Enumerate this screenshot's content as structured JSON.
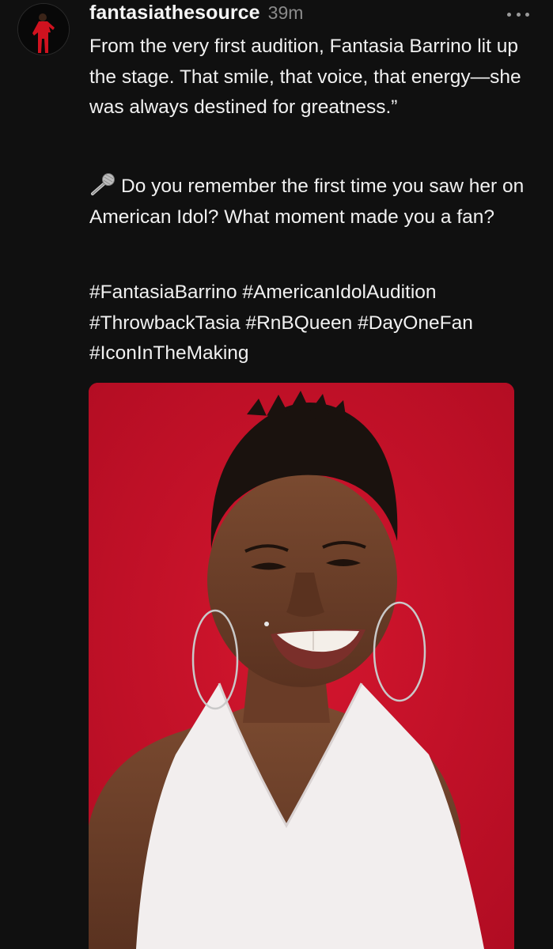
{
  "post": {
    "username": "fantasiathesource",
    "timestamp": "39m",
    "paragraph1": "From the very first audition, Fantasia Barrino lit up the stage. That smile, that voice, that energy—she was always destined for greatness.”",
    "paragraph2": "Do you remember the first time you saw her on American Idol? What moment made you a fan?",
    "paragraph2_icon": "microphone-icon",
    "hashtags": "#FantasiaBarrino #AmericanIdolAudition #ThrowbackTasia #RnBQueen #DayOneFan #IconInTheMaking"
  },
  "colors": {
    "background": "#101010",
    "text": "#f1f1f1",
    "muted": "#8a8a8a",
    "photo_background": "#c8102a"
  },
  "icons": {
    "more": "more-horizontal-icon",
    "avatar": "profile-avatar"
  }
}
